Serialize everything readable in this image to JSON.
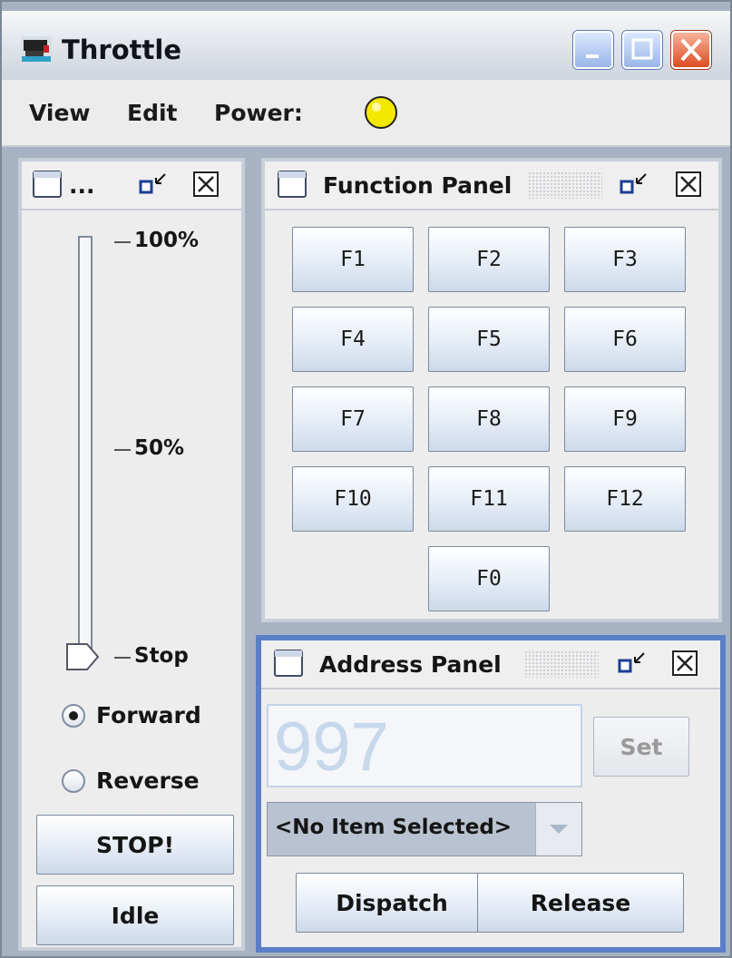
{
  "window": {
    "title": "Throttle",
    "icon": "locomotive-icon"
  },
  "menubar": {
    "view": "View",
    "edit": "Edit",
    "power_label": "Power:",
    "power_color": "#f5e800"
  },
  "speed_panel": {
    "title": "...",
    "ticks": [
      "100%",
      "50%",
      "Stop"
    ],
    "speed_percent": 0,
    "direction_forward": "Forward",
    "direction_reverse": "Reverse",
    "selected_direction": "Forward",
    "stop_label": "STOP!",
    "idle_label": "Idle"
  },
  "function_panel": {
    "title": "Function Panel",
    "buttons": [
      "F1",
      "F2",
      "F3",
      "F4",
      "F5",
      "F6",
      "F7",
      "F8",
      "F9",
      "F10",
      "F11",
      "F12",
      "F0"
    ]
  },
  "address_panel": {
    "title": "Address Panel",
    "address_value": "997",
    "set_label": "Set",
    "roster_selected": "<No Item Selected>",
    "dispatch_label": "Dispatch",
    "release_label": "Release"
  },
  "colors": {
    "accent_border": "#5a7fc8",
    "frame_border": "#c7cfd9"
  }
}
